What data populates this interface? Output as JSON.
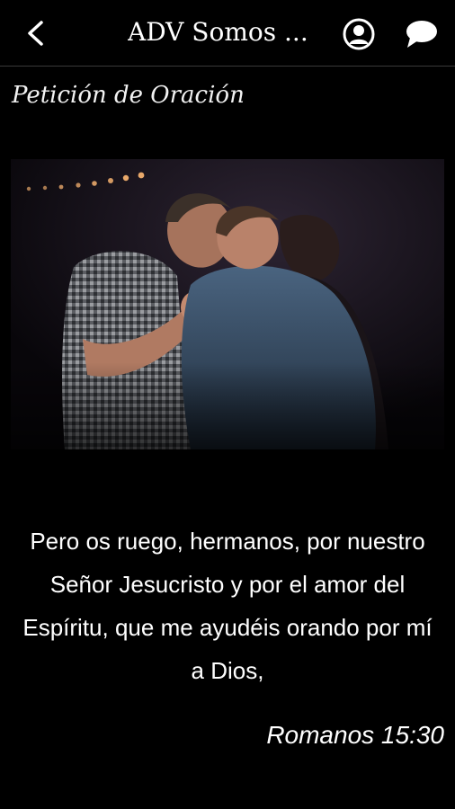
{
  "header": {
    "title": "ADV Somos ...",
    "icons": {
      "back": "chevron-left-icon",
      "profile": "user-circle-icon",
      "chat": "chat-bubble-icon"
    }
  },
  "page": {
    "title": "Petición de Oración"
  },
  "hero": {
    "description": "photo of people praying together"
  },
  "content": {
    "verse": "Pero os ruego, hermanos, por nuestro Señor Jesucristo y por el amor del Espíritu, que me ayudéis orando por mí a Dios,",
    "reference": "Romanos 15:30"
  },
  "colors": {
    "background": "#000000",
    "text": "#ffffff",
    "divider": "#3a3a3a"
  }
}
